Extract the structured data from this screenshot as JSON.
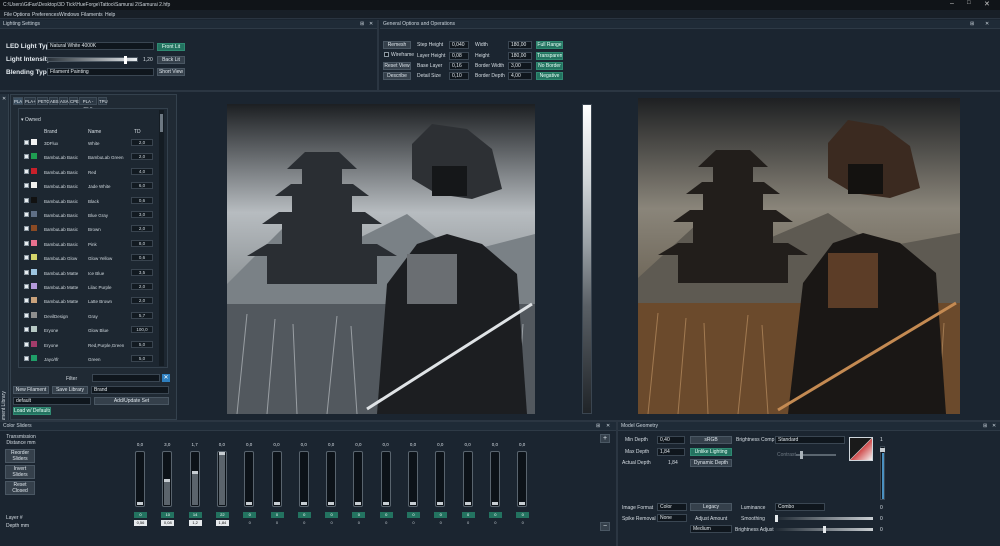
{
  "window": {
    "title": "C:\\Users\\GiFax\\Desktop\\3D Tick\\HueForge\\Tattoo\\Samurai 2\\Samurai 2.hfp"
  },
  "menu": [
    "File",
    "Options",
    "Preferences",
    "Windows",
    "Filaments",
    "Help"
  ],
  "lighting": {
    "title": "Lighting Settings",
    "led_label": "LED Light Type",
    "led_value": "Natural White 4000K",
    "intensity_label": "Light Intensity",
    "intensity_value": "1,20",
    "intensity_fraction": 0.86,
    "blend_label": "Blending Type",
    "blend_value": "Filament Painting",
    "front_lit": "Front Lit",
    "back_lit": "Back Lit",
    "short_view": "Short View"
  },
  "general": {
    "title": "General Options and Operations",
    "remesh": "Remesh",
    "wireframe": "Wireframe",
    "reset_view": "Reset View",
    "describe": "Describe",
    "step_height_label": "Step Height",
    "step_height": "0,040",
    "layer_height_label": "Layer Height",
    "layer_height": "0,08",
    "base_layer_label": "Base Layer",
    "base_layer": "0,16",
    "detail_size_label": "Detail Size",
    "detail_size": "0,10",
    "width_label": "Width",
    "width": "180,00",
    "height_label": "Height",
    "height": "180,00",
    "border_width_label": "Border Width",
    "border_width": "3,00",
    "border_depth_label": "Border Depth",
    "border_depth": "4,00",
    "full_range": "Full Range",
    "transparent": "Transparent",
    "no_border": "No Border",
    "negative": "Negative"
  },
  "filament_library": {
    "side_label": "Filament Library",
    "tabs": [
      "PLA",
      "PLA+",
      "PETG",
      "ABS",
      "ASA",
      "CPE",
      "PLA - SILK",
      "TPU"
    ],
    "group": "Owned",
    "columns": {
      "brand": "Brand",
      "name": "Name",
      "td": "TD"
    },
    "rows": [
      {
        "brand": "3DFlux",
        "name": "White",
        "td": "2,0",
        "color": "#f2f2f2"
      },
      {
        "brand": "BambuLab Basic",
        "name": "BambuLab Green",
        "td": "2,0",
        "color": "#1f9e52"
      },
      {
        "brand": "BambuLab Basic",
        "name": "Red",
        "td": "4,0",
        "color": "#c8202a"
      },
      {
        "brand": "BambuLab Basic",
        "name": "Jade White",
        "td": "6,0",
        "color": "#f0f0ee"
      },
      {
        "brand": "BambuLab Basic",
        "name": "Black",
        "td": "0,6",
        "color": "#111111"
      },
      {
        "brand": "BambuLab Basic",
        "name": "Blue Gray",
        "td": "3,0",
        "color": "#5f6f86"
      },
      {
        "brand": "BambuLab Basic",
        "name": "Brown",
        "td": "2,0",
        "color": "#8a4a24"
      },
      {
        "brand": "BambuLab Basic",
        "name": "Pink",
        "td": "8,0",
        "color": "#e8718f"
      },
      {
        "brand": "BambuLab Glow",
        "name": "Glow Yellow",
        "td": "0,6",
        "color": "#d4d46a"
      },
      {
        "brand": "BambuLab Matte",
        "name": "Ice Blue",
        "td": "3,5",
        "color": "#9cc4e0"
      },
      {
        "brand": "BambuLab Matte",
        "name": "Lilac Purple",
        "td": "2,0",
        "color": "#b49adc"
      },
      {
        "brand": "BambuLab Matte",
        "name": "Latte Brown",
        "td": "2,0",
        "color": "#c9a27c"
      },
      {
        "brand": "DevilDesign",
        "name": "Gray",
        "td": "5,7",
        "color": "#8e8e8e"
      },
      {
        "brand": "Eryone",
        "name": "Glow Blue",
        "td": "100,0",
        "color": "#b7c9c4"
      },
      {
        "brand": "Eryone",
        "name": "Red,Purple,Green",
        "td": "5,0",
        "color": "#a23c6a"
      },
      {
        "brand": "Jayo/Ifr",
        "name": "Green",
        "td": "5,0",
        "color": "#1f9e68"
      }
    ],
    "filter_label": "Filter",
    "new_filament": "New Filament",
    "save_library": "Save Library",
    "brand_value": "Brand",
    "default_value": "default",
    "add_update_set": "Add/Update Set",
    "load_defaults": "Load w/ Defaults"
  },
  "color_sliders": {
    "title": "Color Sliders",
    "transmission_label": "Transmission Distance mm",
    "reorder": "Reorder Sliders",
    "invert": "Invert Sliders",
    "reset_closed": "Reset Closed Sliders",
    "layer_label": "Layer #",
    "depth_label": "Depth mm",
    "add": "+",
    "remove": "−",
    "sliders": [
      {
        "top": "0,0",
        "layer": "0",
        "depth": "0,56",
        "level": 0.0
      },
      {
        "top": "3,0",
        "layer": "10",
        "depth": "0,08",
        "level": 0.45
      },
      {
        "top": "1,7",
        "layer": "14",
        "depth": "1,2",
        "level": 0.62
      },
      {
        "top": "0,0",
        "layer": "22",
        "depth": "1,84",
        "level": 1.0
      },
      {
        "top": "0,0",
        "layer": "0",
        "depth": "0",
        "level": 0.0
      },
      {
        "top": "0,0",
        "layer": "0",
        "depth": "0",
        "level": 0.0
      },
      {
        "top": "0,0",
        "layer": "0",
        "depth": "0",
        "level": 0.0
      },
      {
        "top": "0,0",
        "layer": "0",
        "depth": "0",
        "level": 0.0
      },
      {
        "top": "0,0",
        "layer": "0",
        "depth": "0",
        "level": 0.0
      },
      {
        "top": "0,0",
        "layer": "0",
        "depth": "0",
        "level": 0.0
      },
      {
        "top": "0,0",
        "layer": "0",
        "depth": "0",
        "level": 0.0
      },
      {
        "top": "0,0",
        "layer": "0",
        "depth": "0",
        "level": 0.0
      },
      {
        "top": "0,0",
        "layer": "0",
        "depth": "0",
        "level": 0.0
      },
      {
        "top": "0,0",
        "layer": "0",
        "depth": "0",
        "level": 0.0
      },
      {
        "top": "0,0",
        "layer": "0",
        "depth": "0",
        "level": 0.0
      }
    ]
  },
  "model_geometry": {
    "title": "Model Geometry",
    "min_depth_label": "Min Depth",
    "min_depth": "0,40",
    "max_depth_label": "Max Depth",
    "max_depth": "1,84",
    "actual_depth_label": "Actual Depth",
    "actual_depth": "1,84",
    "sRGB": "sRGB",
    "unlike_lighting": "Unlike Lighting",
    "dynamic_depth": "Dynamic Depth",
    "brightness_comp_label": "Brightness Comp",
    "brightness_comp": "Standard",
    "contrast_label": "Contrast",
    "image_format_label": "Image Format",
    "image_format": "Color",
    "legacy": "Legacy",
    "luminance_label": "Luminance",
    "luminance": "Combo",
    "spike_removal_label": "Spike Removal",
    "spike_removal": "None",
    "adjust_amount_label": "Adjust Amount",
    "adjust_amount": "Medium",
    "smoothing_label": "Smoothing",
    "brightness_adjust_label": "Brightness Adjust",
    "scale_top": "1",
    "scale_mid": "0",
    "scale_bottom": "0"
  },
  "colors": {
    "accent": "#237360",
    "panel": "#1b2530",
    "field": "#0f161d"
  }
}
